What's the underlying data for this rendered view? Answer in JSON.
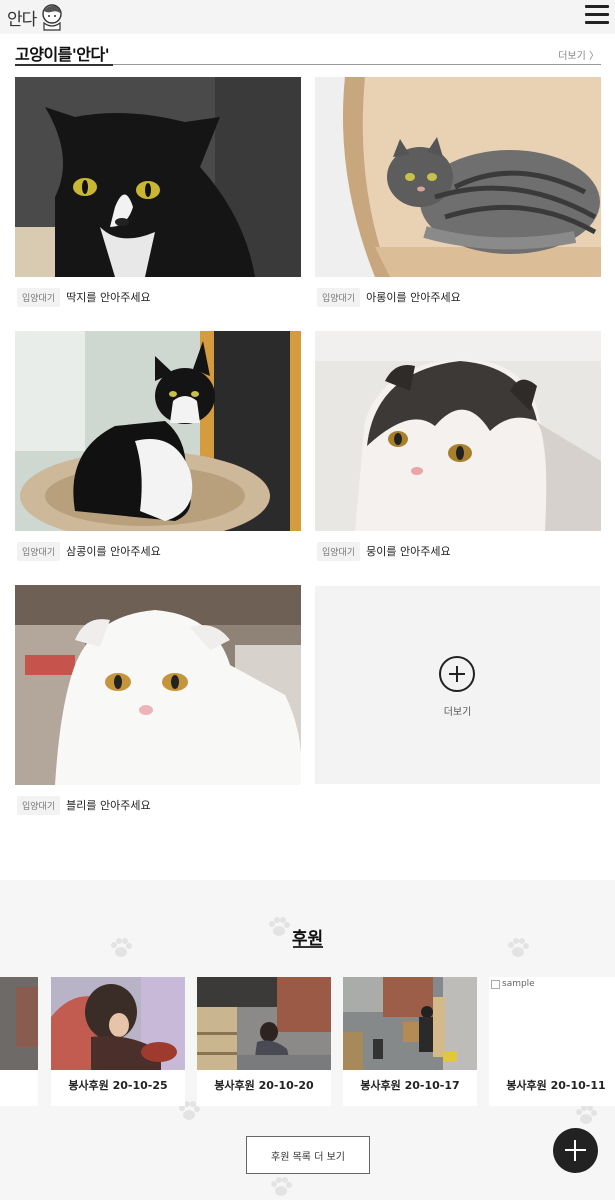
{
  "header": {
    "logo_text": "안다",
    "menu_icon": "hamburger-icon"
  },
  "cats_section": {
    "title": "고양이를'안다'",
    "more_label": "더보기 〉",
    "cards": [
      {
        "badge": "입양대기",
        "name": "딱지를 안아주세요"
      },
      {
        "badge": "입양대기",
        "name": "아롱이를 안아주세요"
      },
      {
        "badge": "입양대기",
        "name": "삼콩이를 안아주세요"
      },
      {
        "badge": "입양대기",
        "name": "뭉이를 안아주세요"
      },
      {
        "badge": "입양대기",
        "name": "블리를 안아주세요"
      }
    ],
    "more_card": {
      "label": "더보기",
      "icon": "plus-circle-icon"
    }
  },
  "support_section": {
    "title": "후원",
    "cards": [
      {
        "label": "봉사후원 20-10-25"
      },
      {
        "label": "봉사후원 20-10-20"
      },
      {
        "label": "봉사후원 20-10-17"
      },
      {
        "label": "봉사후원 20-10-11",
        "image_alt": "sample"
      }
    ],
    "list_more_button": "후원 목록 더 보기"
  },
  "fab_icon": "plus-icon"
}
